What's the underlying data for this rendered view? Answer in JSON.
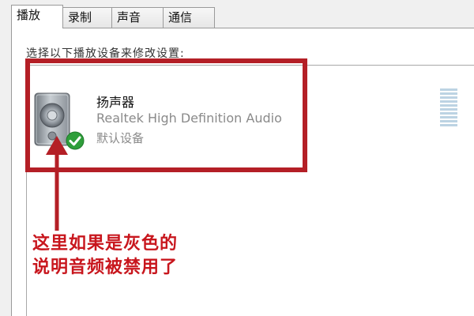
{
  "tabs": [
    {
      "label": "播放",
      "active": true
    },
    {
      "label": "录制",
      "active": false
    },
    {
      "label": "声音",
      "active": false
    },
    {
      "label": "通信",
      "active": false
    }
  ],
  "playback": {
    "instruction": "选择以下播放设备来修改设置:",
    "device": {
      "name": "扬声器",
      "driver": "Realtek High Definition Audio",
      "status": "默认设备",
      "icon": "speaker-icon",
      "status_icon": "green-check-icon",
      "level_icon": "volume-level-meter"
    }
  },
  "annotation": {
    "color": "#c8161d",
    "line1": "这里如果是灰色的",
    "line2": "说明音频被禁用了"
  },
  "colors": {
    "annotation_red": "#b41f26",
    "check_green": "#2e9e3a",
    "meter_blue": "#bcd3e3"
  }
}
